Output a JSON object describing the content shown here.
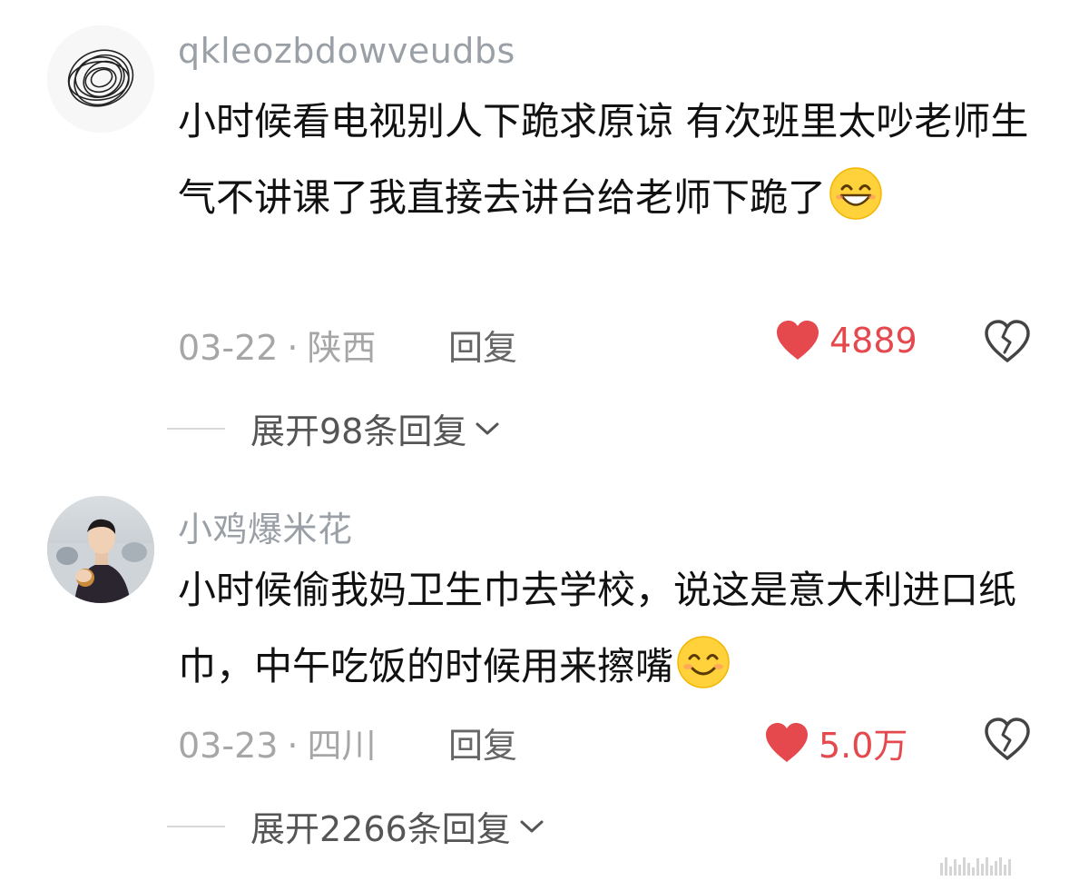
{
  "comments": [
    {
      "username": "qkleozbdowveudbs",
      "text": "小时候看电视别人下跪求原谅 有次班里太吵老师生气不讲课了我直接去讲台给老师下跪了",
      "emoji_icon": "grinning-face-icon",
      "date": "03-22",
      "separator": "·",
      "location": "陕西",
      "reply_label": "回复",
      "like_count": "4889",
      "expand_label": "展开98条回复"
    },
    {
      "username": "小鸡爆米花",
      "text": "小时候偷我妈卫生巾去学校，说这是意大利进口纸巾，中午吃饭的时候用来擦嘴",
      "emoji_icon": "smiling-face-icon",
      "date": "03-23",
      "separator": "·",
      "location": "四川",
      "reply_label": "回复",
      "like_count": "5.0万",
      "expand_label": "展开2266条回复"
    }
  ],
  "colors": {
    "like": "#e5484d",
    "username": "#9aa0a6",
    "body": "#111111",
    "meta": "#a6a6a6"
  }
}
